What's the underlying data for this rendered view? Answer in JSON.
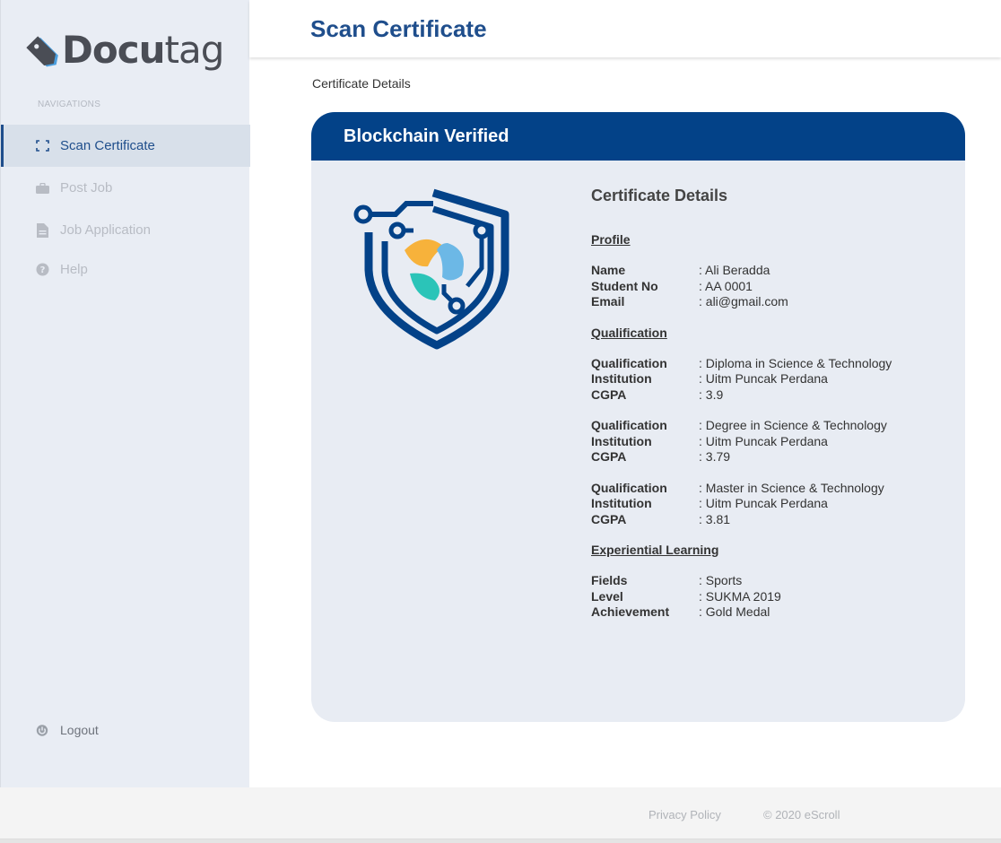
{
  "brand": {
    "name_bold": "Docu",
    "name_light": "tag"
  },
  "sidebar": {
    "heading": "NAVIGATIONS",
    "items": [
      {
        "label": "Scan Certificate",
        "icon": "scan-icon",
        "active": true
      },
      {
        "label": "Post Job",
        "icon": "briefcase-icon",
        "active": false
      },
      {
        "label": "Job Application",
        "icon": "document-icon",
        "active": false
      },
      {
        "label": "Help",
        "icon": "question-icon",
        "active": false
      }
    ],
    "logout": {
      "label": "Logout",
      "icon": "power-icon"
    }
  },
  "header": {
    "title": "Scan Certificate"
  },
  "breadcrumb": "Certificate Details",
  "card": {
    "banner": "Blockchain Verified",
    "title": "Certificate Details",
    "profile": {
      "heading": "Profile",
      "rows": [
        {
          "k": "Name",
          "v": ": Ali Beradda"
        },
        {
          "k": "Student No",
          "v": ": AA 0001"
        },
        {
          "k": "Email",
          "v": ": ali@gmail.com"
        }
      ]
    },
    "qualification": {
      "heading": "Qualification",
      "groups": [
        [
          {
            "k": "Qualification",
            "v": ": Diploma in Science & Technology"
          },
          {
            "k": "Institution",
            "v": ": Uitm Puncak Perdana"
          },
          {
            "k": "CGPA",
            "v": ": 3.9"
          }
        ],
        [
          {
            "k": "Qualification",
            "v": ": Degree in Science & Technology"
          },
          {
            "k": "Institution",
            "v": ": Uitm Puncak Perdana"
          },
          {
            "k": "CGPA",
            "v": ": 3.79"
          }
        ],
        [
          {
            "k": "Qualification",
            "v": ": Master in Science & Technology"
          },
          {
            "k": "Institution",
            "v": ": Uitm Puncak Perdana"
          },
          {
            "k": "CGPA",
            "v": ": 3.81"
          }
        ]
      ]
    },
    "experiential": {
      "heading": "Experiential Learning",
      "rows": [
        {
          "k": "Fields",
          "v": ": Sports"
        },
        {
          "k": "Level",
          "v": ": SUKMA 2019"
        },
        {
          "k": "Achievement",
          "v": ": Gold Medal"
        }
      ]
    }
  },
  "footer": {
    "privacy": "Privacy Policy",
    "copyright": "© 2020 eScroll"
  },
  "colors": {
    "primary": "#034288",
    "accent_orange": "#f7b23b",
    "accent_blue": "#6cb8e6",
    "accent_teal": "#2bc4b8"
  }
}
